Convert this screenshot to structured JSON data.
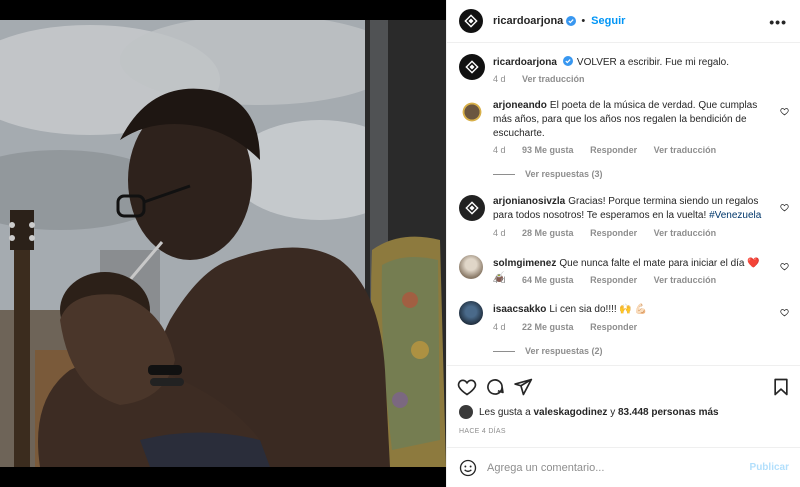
{
  "post": {
    "author": "ricardoarjona",
    "follow_label": "Seguir",
    "separator": "•",
    "more": "•••",
    "caption_text": "VOLVER a escribir. Fue mi regalo.",
    "caption_age": "4 d",
    "caption_translate": "Ver traducción"
  },
  "comments": [
    {
      "user": "arjoneando",
      "text": "El poeta de la música de verdad. Que cumplas más años, para que los años nos regalen la bendición de escucharte.",
      "age": "4 d",
      "likes": "93 Me gusta",
      "reply": "Responder",
      "translate": "Ver traducción",
      "view_replies": "Ver respuestas (3)"
    },
    {
      "user": "arjonianosivzla",
      "text": "Gracias! Porque termina siendo un regalos para todos nosotros! Te esperamos en la vuelta!",
      "tag": "#Venezuela",
      "tail": " ve",
      "age": "4 d",
      "likes": "28 Me gusta",
      "reply": "Responder",
      "translate": "Ver traducción"
    },
    {
      "user": "solmgimenez",
      "text": "Que nunca falte el mate para iniciar el día ❤️ 🧉",
      "age": "4 d",
      "likes": "64 Me gusta",
      "reply": "Responder",
      "translate": "Ver traducción"
    },
    {
      "user": "isaacsakko",
      "text": "Li cen sia do!!!! 🙌 💪🏻",
      "age": "4 d",
      "likes": "22 Me gusta",
      "reply": "Responder",
      "view_replies": "Ver respuestas (2)"
    }
  ],
  "likes_summary": {
    "prefix": "Les gusta a",
    "user": "valeskagodinez",
    "middle": "y",
    "count": "83.448 personas más"
  },
  "timestamp": "HACE 4 DÍAS",
  "add_comment": {
    "placeholder": "Agrega un comentario...",
    "publish": "Publicar"
  },
  "colors": {
    "link": "#0095f6",
    "muted": "#8e8e8e",
    "publish_disabled": "#b2dffc"
  }
}
